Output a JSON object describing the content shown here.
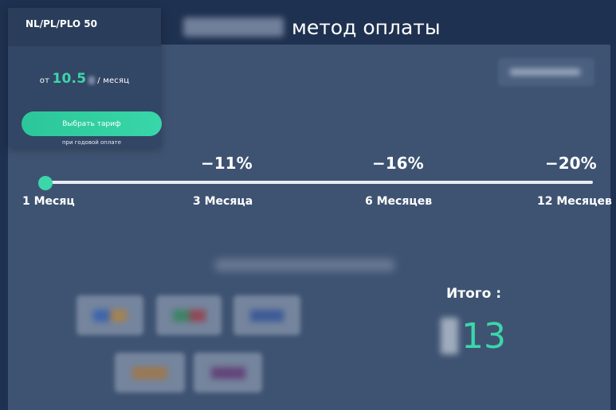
{
  "header": {
    "title_visible": "метод оплаты"
  },
  "plan": {
    "name": "NL/PL/PLO 50",
    "price_prefix": "от",
    "price_value": "10.5",
    "price_suffix": "/ месяц",
    "choose_button_label": "Выбрать тариф",
    "annual_note": "при годовой оплате"
  },
  "period_selector": {
    "options": [
      {
        "label": "1 Месяц",
        "discount": ""
      },
      {
        "label": "3 Месяца",
        "discount": "−11%"
      },
      {
        "label": "6 Месяцев",
        "discount": "−16%"
      },
      {
        "label": "12 Месяцев",
        "discount": "−20%"
      }
    ],
    "selected_index": 0,
    "accent_color": "#3cd6aa"
  },
  "total": {
    "label": "Итого :",
    "amount": "13"
  },
  "colors": {
    "background": "#1f3150",
    "panel": "#3e5372",
    "card": "#324665",
    "accent": "#3cd6aa"
  }
}
